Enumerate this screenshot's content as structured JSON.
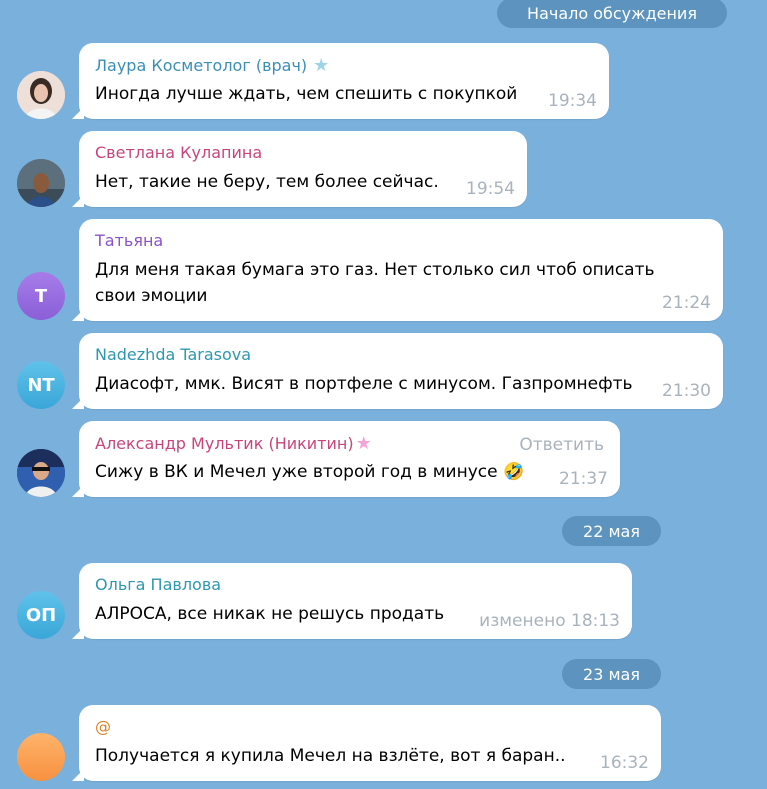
{
  "header_pill": "Начало обсуждения",
  "date_pills": {
    "may22": "22 мая",
    "may23": "23 мая"
  },
  "messages": [
    {
      "author": "Лаура Косметолог (врач)",
      "text": "Иногда лучше ждать, чем спешить с покупкой",
      "time": "19:34",
      "name_color": "#3a8fb7"
    },
    {
      "author": "Светлана Кулапина",
      "text": "Нет, такие не беру, тем более сейчас.",
      "time": "19:54",
      "name_color": "#c8457c"
    },
    {
      "author": "Татьяна",
      "text_line1": "Для меня такая бумага это газ. Нет столько сил чтоб описать",
      "text_line2": "свои эмоции",
      "time": "21:24",
      "avatar_initials": "Т",
      "name_color": "#8c52c9"
    },
    {
      "author": "Nadezhda Tarasova",
      "text": "Диасофт, ммк. Висят в портфеле с минусом. Газпромнефть",
      "time": "21:30",
      "avatar_initials": "NT",
      "name_color": "#2f97b0"
    },
    {
      "author": "Александр Мультик (Никитин)",
      "text": "Сижу в ВК и Мечел уже второй год в минусе",
      "emoji": "🤣",
      "time": "21:37",
      "reply_label": "Ответить",
      "name_color": "#c8457c"
    },
    {
      "author": "Ольга Павлова",
      "text": "АЛРОСА, все никак не решусь продать",
      "time": "изменено 18:13",
      "avatar_initials": "ОП",
      "name_color": "#2f97b0"
    },
    {
      "author": "@",
      "text": "Получается я купила Мечел на взлёте, вот я баран..",
      "time": "16:32",
      "name_color": "#d9822b"
    }
  ],
  "icons": {
    "premium_star": "star-icon",
    "premium_star_pink": "star-icon"
  }
}
